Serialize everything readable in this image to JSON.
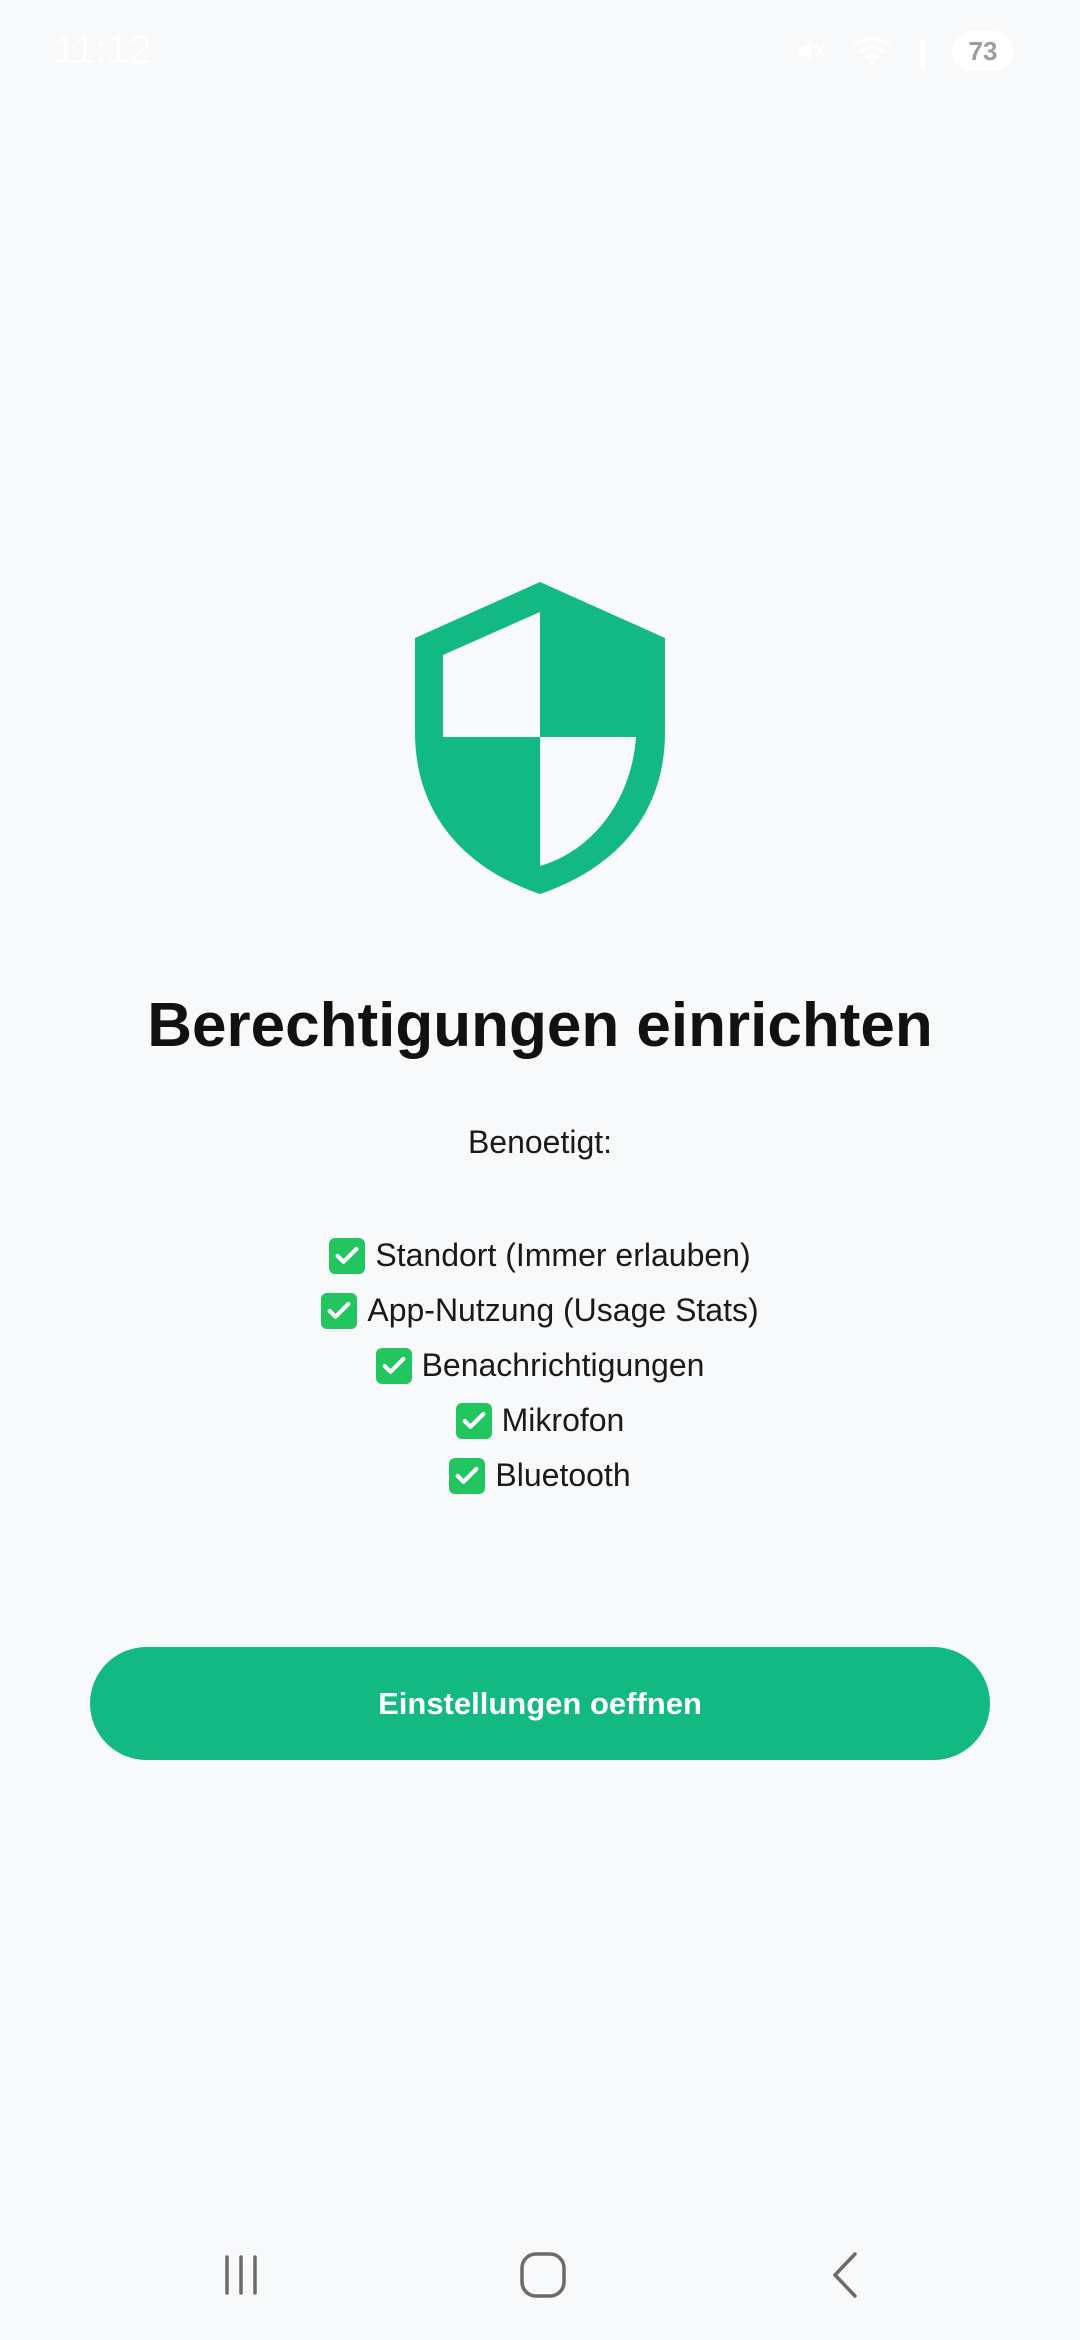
{
  "status_bar": {
    "time": "11:12",
    "battery": "73"
  },
  "icons": {
    "shield": "shield-icon",
    "check": "check-box-icon",
    "mute": "mute-icon",
    "wifi": "wifi-icon",
    "signal": "signal-icon"
  },
  "colors": {
    "accent": "#13b982",
    "background": "#f8f9fa",
    "check": "#22c55e"
  },
  "main": {
    "title": "Berechtigungen einrichten",
    "subtitle": "Benoetigt:",
    "permissions": [
      {
        "label": "Standort (Immer erlauben)"
      },
      {
        "label": "App-Nutzung (Usage Stats)"
      },
      {
        "label": "Benachrichtigungen"
      },
      {
        "label": "Mikrofon"
      },
      {
        "label": "Bluetooth"
      }
    ],
    "button_label": "Einstellungen oeffnen"
  }
}
